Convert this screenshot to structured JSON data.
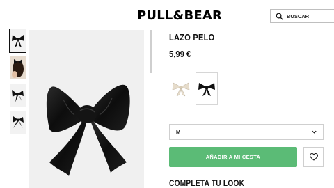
{
  "header": {
    "logo": "PULL&BEAR",
    "search_placeholder": "BUSCAR",
    "search_icon": "search-icon"
  },
  "gallery": {
    "thumbnails": [
      {
        "name": "thumb-bow-front",
        "active": true
      },
      {
        "name": "thumb-model-hair"
      },
      {
        "name": "thumb-bow-angle"
      },
      {
        "name": "thumb-bow-side"
      }
    ],
    "main_image": "black-satin-hair-bow"
  },
  "product": {
    "title": "LAZO PELO",
    "price": "5,99 €",
    "colors": [
      {
        "name": "cream",
        "hex": "#e6dccb",
        "selected": false
      },
      {
        "name": "black",
        "hex": "#111111",
        "selected": true
      }
    ],
    "size": "M",
    "add_to_cart": "AÑADIR A MI CESTA",
    "wishlist_icon": "heart-icon",
    "complete_look": "COMPLETA TU LOOK"
  },
  "colors": {
    "accent_green": "#5bbb76",
    "border": "#cfcfcf"
  }
}
